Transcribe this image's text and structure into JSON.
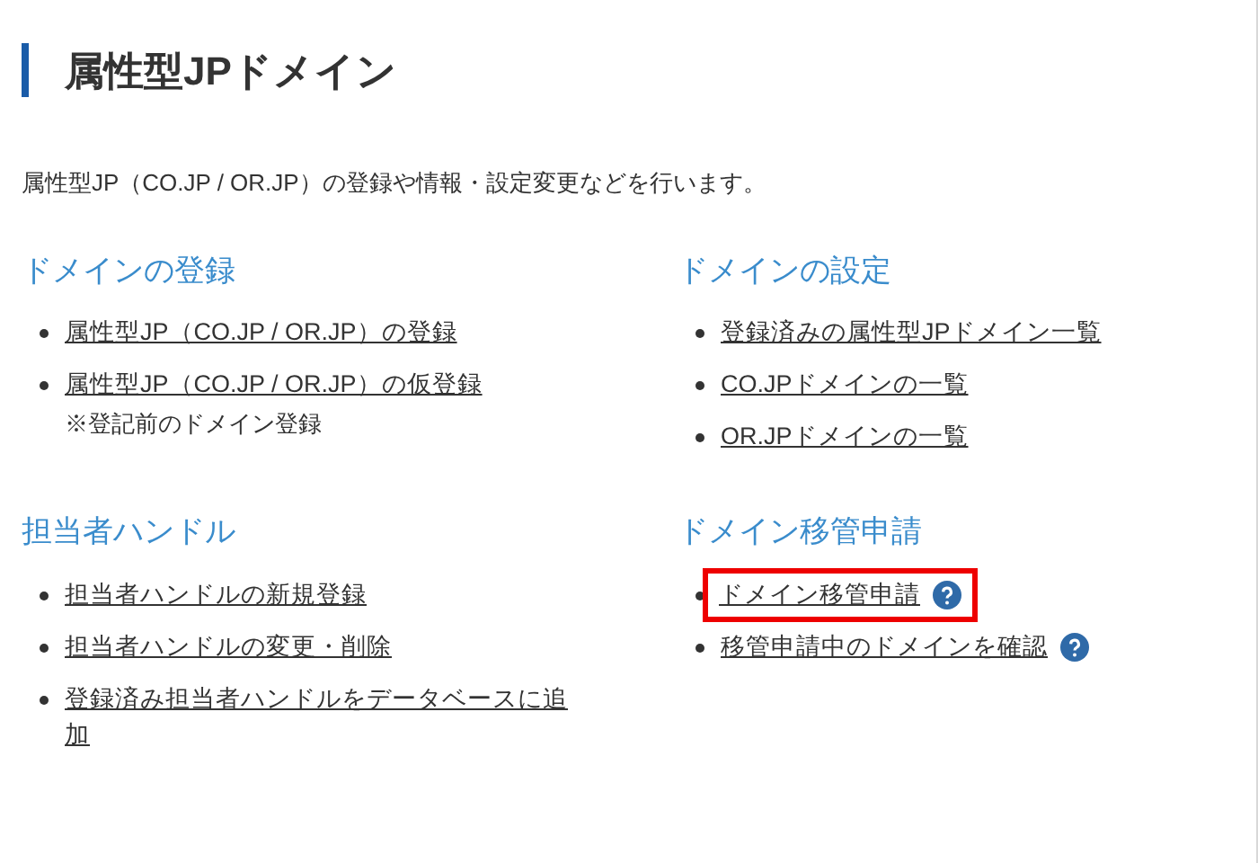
{
  "title": "属性型JPドメイン",
  "intro": "属性型JP（CO.JP / OR.JP）の登録や情報・設定変更などを行います。",
  "sections": [
    {
      "heading": "ドメインの登録",
      "links": [
        {
          "text": "属性型JP（CO.JP / OR.JP）の登録",
          "help": false,
          "highlighted": false
        },
        {
          "text": "属性型JP（CO.JP / OR.JP）の仮登録",
          "note": "※登記前のドメイン登録",
          "help": false,
          "highlighted": false
        }
      ]
    },
    {
      "heading": "ドメインの設定",
      "links": [
        {
          "text": "登録済みの属性型JPドメイン一覧",
          "help": false,
          "highlighted": false
        },
        {
          "text": "CO.JPドメインの一覧",
          "help": false,
          "highlighted": false
        },
        {
          "text": "OR.JPドメインの一覧",
          "help": false,
          "highlighted": false
        }
      ]
    },
    {
      "heading": "担当者ハンドル",
      "links": [
        {
          "text": "担当者ハンドルの新規登録",
          "help": false,
          "highlighted": false
        },
        {
          "text": "担当者ハンドルの変更・削除",
          "help": false,
          "highlighted": false
        },
        {
          "text": "登録済み担当者ハンドルをデータベースに追加",
          "help": false,
          "highlighted": false
        }
      ]
    },
    {
      "heading": "ドメイン移管申請",
      "links": [
        {
          "text": "ドメイン移管申請",
          "help": true,
          "highlighted": true
        },
        {
          "text": "移管申請中のドメインを確認",
          "help": true,
          "highlighted": false
        }
      ]
    }
  ]
}
